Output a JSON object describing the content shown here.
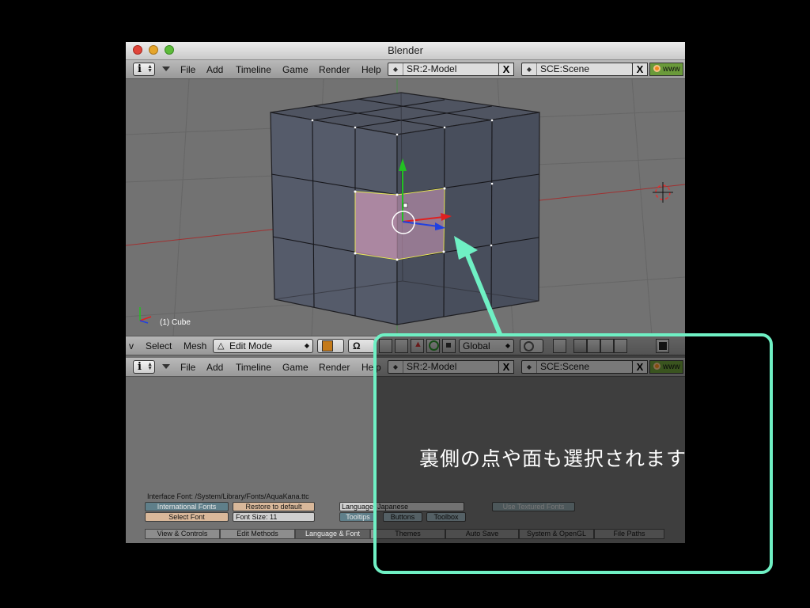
{
  "window": {
    "title": "Blender"
  },
  "top_header": {
    "menus": [
      "File",
      "Add",
      "Timeline",
      "Game",
      "Render",
      "Help"
    ],
    "screen_field": "SR:2-Model",
    "scene_field": "SCE:Scene",
    "close_glyph": "X",
    "www_label": "www"
  },
  "viewport": {
    "object_label": "(1) Cube",
    "selection_color": "#c896b4",
    "manipulator_colors": {
      "y": "#22c022",
      "x": "#e02020",
      "z": "#2040e0"
    }
  },
  "view3d_header": {
    "view_label": "v",
    "select_label": "Select",
    "mesh_label": "Mesh",
    "mode_label": "Edit Mode",
    "orientation_label": "Global"
  },
  "prefs_header": {
    "menus": [
      "File",
      "Add",
      "Timeline",
      "Game",
      "Render",
      "Help"
    ],
    "screen_field": "SR:2-Model",
    "scene_field": "SCE:Scene",
    "close_glyph": "X",
    "www_label": "www"
  },
  "prefs": {
    "interface_font": "Interface Font: /System/Library/Fonts/AquaKana.ttc",
    "intl_fonts_button": "International Fonts",
    "restore_default_button": "Restore to default",
    "select_font_button": "Select Font",
    "font_size_field": "Font Size:  11",
    "language_label": "Language:",
    "language_value": "Japanese",
    "textured_fonts_button": "Use Textured Fonts",
    "tooltips_button": "Tooltips",
    "buttons_button": "Buttons",
    "toolbox_button": "Toolbox",
    "tabs": [
      "View & Controls",
      "Edit Methods",
      "Language & Font",
      "Themes",
      "Auto Save",
      "System & OpenGL",
      "File Paths"
    ],
    "active_tab": "Language & Font"
  },
  "annotation": {
    "text": "裏側の点や面も選択されます",
    "accent_color": "#6ff0c4"
  }
}
